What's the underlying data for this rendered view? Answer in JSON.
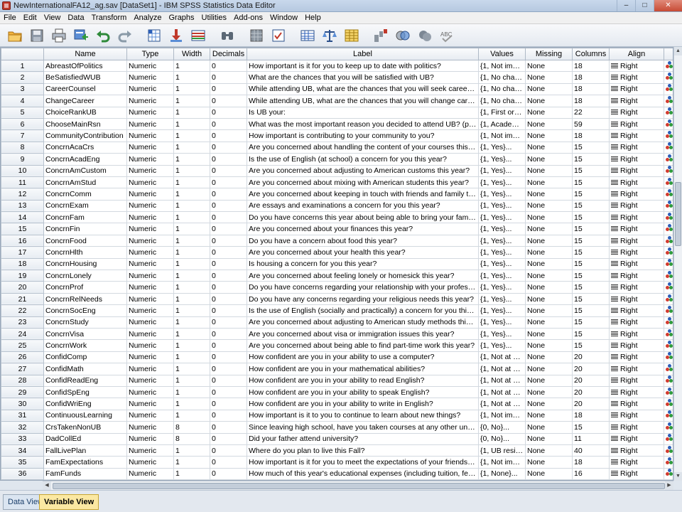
{
  "window": {
    "title": "NewInternationalFA12_ag.sav [DataSet1] - IBM SPSS Statistics Data Editor",
    "minimize": "–",
    "maximize": "□",
    "close": "✕"
  },
  "menu": [
    "File",
    "Edit",
    "View",
    "Data",
    "Transform",
    "Analyze",
    "Graphs",
    "Utilities",
    "Add-ons",
    "Window",
    "Help"
  ],
  "toolbar_icons": [
    "open-icon",
    "save-icon",
    "print-icon",
    "dialog-recall-icon",
    "undo-icon",
    "redo-icon",
    "goto-case-icon",
    "goto-variable-icon",
    "variables-icon",
    "find-icon",
    "insert-cases-icon",
    "insert-variable-icon",
    "split-file-icon",
    "weight-cases-icon",
    "select-cases-icon",
    "value-labels-icon",
    "use-variable-sets-icon",
    "show-all-variables-icon",
    "spelling-icon"
  ],
  "columns": [
    "Name",
    "Type",
    "Width",
    "Decimals",
    "Label",
    "Values",
    "Missing",
    "Columns",
    "Align"
  ],
  "align_value": "Right",
  "rows": [
    {
      "n": "1",
      "name": "AbreastOfPolitics",
      "type": "Numeric",
      "width": "1",
      "dec": "0",
      "label": "How important is it for you to keep up to date with politics?",
      "values": "{1, Not impo...",
      "missing": "None",
      "cols": "18"
    },
    {
      "n": "2",
      "name": "BeSatisfiedWUB",
      "type": "Numeric",
      "width": "1",
      "dec": "0",
      "label": "What are the chances that you will be satisfied with UB?",
      "values": "{1, No chan...",
      "missing": "None",
      "cols": "18"
    },
    {
      "n": "3",
      "name": "CareerCounsel",
      "type": "Numeric",
      "width": "1",
      "dec": "0",
      "label": "While attending UB, what are the chances that you will seek career advi...",
      "values": "{1, No chan...",
      "missing": "None",
      "cols": "18"
    },
    {
      "n": "4",
      "name": "ChangeCareer",
      "type": "Numeric",
      "width": "1",
      "dec": "0",
      "label": "While attending UB, what are the chances that you will change career c...",
      "values": "{1, No chan...",
      "missing": "None",
      "cols": "18"
    },
    {
      "n": "5",
      "name": "ChoiceRankUB",
      "type": "Numeric",
      "width": "1",
      "dec": "0",
      "label": "Is UB your:",
      "values": "{1, First or o...",
      "missing": "None",
      "cols": "22"
    },
    {
      "n": "6",
      "name": "ChooseMainRsn",
      "type": "Numeric",
      "width": "1",
      "dec": "0",
      "label": "What was the most important reason you decided to attend UB? (please...",
      "values": "{1, Academi...",
      "missing": "None",
      "cols": "59"
    },
    {
      "n": "7",
      "name": "CommunityContribution",
      "type": "Numeric",
      "width": "1",
      "dec": "0",
      "label": "How important is contributing to your community to you?",
      "values": "{1, Not impo...",
      "missing": "None",
      "cols": "18"
    },
    {
      "n": "8",
      "name": "ConcrnAcaCrs",
      "type": "Numeric",
      "width": "1",
      "dec": "0",
      "label": "Are you concerned about handling the content of your courses this year?",
      "values": "{1, Yes}...",
      "missing": "None",
      "cols": "15"
    },
    {
      "n": "9",
      "name": "ConcrnAcadEng",
      "type": "Numeric",
      "width": "1",
      "dec": "0",
      "label": "Is the use of English (at school) a concern for you this year?",
      "values": "{1, Yes}...",
      "missing": "None",
      "cols": "15"
    },
    {
      "n": "10",
      "name": "ConcrnAmCustom",
      "type": "Numeric",
      "width": "1",
      "dec": "0",
      "label": "Are you concerned about adjusting to American customs this year?",
      "values": "{1, Yes}...",
      "missing": "None",
      "cols": "15"
    },
    {
      "n": "11",
      "name": "ConcrnAmStud",
      "type": "Numeric",
      "width": "1",
      "dec": "0",
      "label": "Are you concerned about mixing with American students this year?",
      "values": "{1, Yes}...",
      "missing": "None",
      "cols": "15"
    },
    {
      "n": "12",
      "name": "ConcrnComm",
      "type": "Numeric",
      "width": "1",
      "dec": "0",
      "label": "Are you concerned about keeping in touch with friends and family this ye...",
      "values": "{1, Yes}...",
      "missing": "None",
      "cols": "15"
    },
    {
      "n": "13",
      "name": "ConcrnExam",
      "type": "Numeric",
      "width": "1",
      "dec": "0",
      "label": "Are essays and examinations a concern for you this year?",
      "values": "{1, Yes}...",
      "missing": "None",
      "cols": "15"
    },
    {
      "n": "14",
      "name": "ConcrnFam",
      "type": "Numeric",
      "width": "1",
      "dec": "0",
      "label": "Do you have concerns this year about being able to bring your family wit...",
      "values": "{1, Yes}...",
      "missing": "None",
      "cols": "15"
    },
    {
      "n": "15",
      "name": "ConcrnFin",
      "type": "Numeric",
      "width": "1",
      "dec": "0",
      "label": "Are you concerned about your finances this year?",
      "values": "{1, Yes}...",
      "missing": "None",
      "cols": "15"
    },
    {
      "n": "16",
      "name": "ConcrnFood",
      "type": "Numeric",
      "width": "1",
      "dec": "0",
      "label": "Do you have a concern about food this year?",
      "values": "{1, Yes}...",
      "missing": "None",
      "cols": "15"
    },
    {
      "n": "17",
      "name": "ConcrnHlth",
      "type": "Numeric",
      "width": "1",
      "dec": "0",
      "label": "Are you concerned about your health this year?",
      "values": "{1, Yes}...",
      "missing": "None",
      "cols": "15"
    },
    {
      "n": "18",
      "name": "ConcrnHousing",
      "type": "Numeric",
      "width": "1",
      "dec": "0",
      "label": "Is housing a concern for you this year?",
      "values": "{1, Yes}...",
      "missing": "None",
      "cols": "15"
    },
    {
      "n": "19",
      "name": "ConcrnLonely",
      "type": "Numeric",
      "width": "1",
      "dec": "0",
      "label": "Are you concerned about feeling lonely or homesick this year?",
      "values": "{1, Yes}...",
      "missing": "None",
      "cols": "15"
    },
    {
      "n": "20",
      "name": "ConcrnProf",
      "type": "Numeric",
      "width": "1",
      "dec": "0",
      "label": "Do you have concerns regarding your relationship with your professors th...",
      "values": "{1, Yes}...",
      "missing": "None",
      "cols": "15"
    },
    {
      "n": "21",
      "name": "ConcrnRelNeeds",
      "type": "Numeric",
      "width": "1",
      "dec": "0",
      "label": "Do you have any concerns regarding your religious needs this year?",
      "values": "{1, Yes}...",
      "missing": "None",
      "cols": "15"
    },
    {
      "n": "22",
      "name": "ConcrnSocEng",
      "type": "Numeric",
      "width": "1",
      "dec": "0",
      "label": "Is the use of English (socially and practically) a concern for you this year?",
      "values": "{1, Yes}...",
      "missing": "None",
      "cols": "15"
    },
    {
      "n": "23",
      "name": "ConcrnStudy",
      "type": "Numeric",
      "width": "1",
      "dec": "0",
      "label": "Are you concerned about adjusting to American study methods this year?",
      "values": "{1, Yes}...",
      "missing": "None",
      "cols": "15"
    },
    {
      "n": "24",
      "name": "ConcrnVisa",
      "type": "Numeric",
      "width": "1",
      "dec": "0",
      "label": "Are you concerned about visa or immigration issues this year?",
      "values": "{1, Yes}...",
      "missing": "None",
      "cols": "15"
    },
    {
      "n": "25",
      "name": "ConcrnWork",
      "type": "Numeric",
      "width": "1",
      "dec": "0",
      "label": "Are you concerned about being able to find part-time work this year?",
      "values": "{1, Yes}...",
      "missing": "None",
      "cols": "15"
    },
    {
      "n": "26",
      "name": "ConfidComp",
      "type": "Numeric",
      "width": "1",
      "dec": "0",
      "label": "How confident are you in your ability to use a computer?",
      "values": "{1, Not at all...",
      "missing": "None",
      "cols": "20"
    },
    {
      "n": "27",
      "name": "ConfidMath",
      "type": "Numeric",
      "width": "1",
      "dec": "0",
      "label": "How confident are you in your mathematical abilities?",
      "values": "{1, Not at all...",
      "missing": "None",
      "cols": "20"
    },
    {
      "n": "28",
      "name": "ConfidReadEng",
      "type": "Numeric",
      "width": "1",
      "dec": "0",
      "label": "How confident are you in your ability to read English?",
      "values": "{1, Not at all...",
      "missing": "None",
      "cols": "20"
    },
    {
      "n": "29",
      "name": "ConfidSpEng",
      "type": "Numeric",
      "width": "1",
      "dec": "0",
      "label": "How confident are you in your ability to speak English?",
      "values": "{1, Not at all...",
      "missing": "None",
      "cols": "20"
    },
    {
      "n": "30",
      "name": "ConfidWriEng",
      "type": "Numeric",
      "width": "1",
      "dec": "0",
      "label": "How confident are you in your ability to write in English?",
      "values": "{1, Not at all...",
      "missing": "None",
      "cols": "20"
    },
    {
      "n": "31",
      "name": "ContinuousLearning",
      "type": "Numeric",
      "width": "1",
      "dec": "0",
      "label": "How important is it to you to continue to learn about new things?",
      "values": "{1, Not impo...",
      "missing": "None",
      "cols": "18"
    },
    {
      "n": "32",
      "name": "CrsTakenNonUB",
      "type": "Numeric",
      "width": "8",
      "dec": "0",
      "label": "Since leaving high school, have you taken courses at any other university?",
      "values": "{0, No}...",
      "missing": "None",
      "cols": "15"
    },
    {
      "n": "33",
      "name": "DadCollEd",
      "type": "Numeric",
      "width": "8",
      "dec": "0",
      "label": "Did your father attend university?",
      "values": "{0, No}...",
      "missing": "None",
      "cols": "11"
    },
    {
      "n": "34",
      "name": "FallLivePlan",
      "type": "Numeric",
      "width": "1",
      "dec": "0",
      "label": "Where do you plan to live this Fall?",
      "values": "{1, UB resid...",
      "missing": "None",
      "cols": "40"
    },
    {
      "n": "35",
      "name": "FamExpectations",
      "type": "Numeric",
      "width": "1",
      "dec": "0",
      "label": "How important is it for you to meet the expectations of your friends and f...",
      "values": "{1, Not impo...",
      "missing": "None",
      "cols": "18"
    },
    {
      "n": "36",
      "name": "FamFunds",
      "type": "Numeric",
      "width": "1",
      "dec": "0",
      "label": "How much of this year's educational expenses (including tuition, fees, ro...",
      "values": "{1, None}...",
      "missing": "None",
      "cols": "16"
    }
  ],
  "tabs": {
    "data_view": "Data View",
    "variable_view": "Variable View"
  }
}
